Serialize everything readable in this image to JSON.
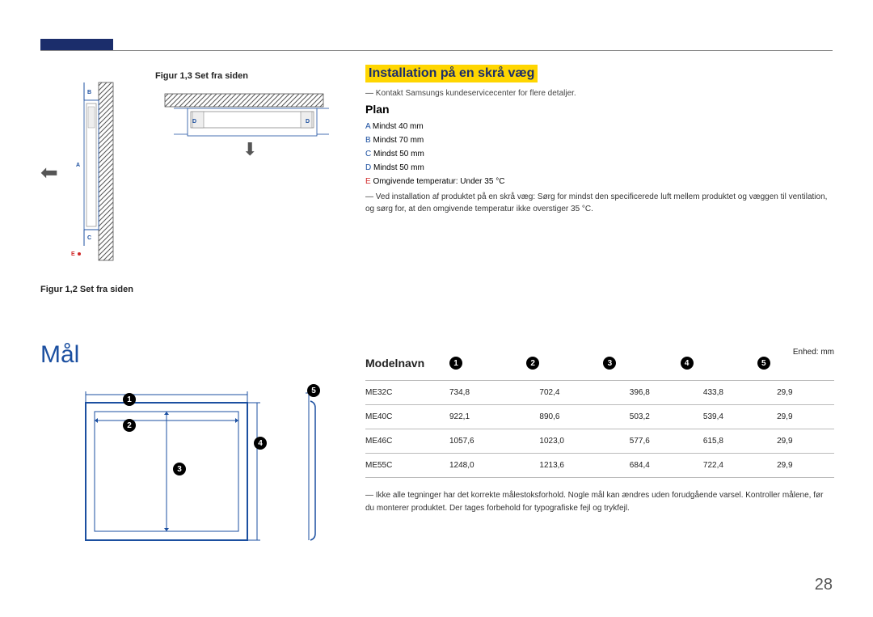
{
  "page_number": "28",
  "figures": {
    "fig13_caption": "Figur 1,3 Set fra siden",
    "fig12_caption": "Figur 1,2 Set fra siden",
    "label_A": "A",
    "label_B": "B",
    "label_C": "C",
    "label_D": "D",
    "label_E": "E"
  },
  "install": {
    "title": "Installation på en skrå væg",
    "contact": "Kontakt Samsungs kundeservicecenter for flere detaljer.",
    "plan_heading": "Plan",
    "specs": {
      "A": "Mindst 40 mm",
      "B": "Mindst 70 mm",
      "C": "Mindst 50 mm",
      "D": "Mindst 50 mm",
      "E": "Omgivende temperatur: Under 35 °C"
    },
    "note": "Ved installation af produktet på en skrå væg: Sørg for mindst den specificerede luft mellem produktet og væggen til ventilation, og sørg for, at den omgivende temperatur ikke overstiger 35 °C."
  },
  "maal": {
    "title": "Mål",
    "unit": "Enhed: mm",
    "model_header": "Modelnavn",
    "badges": [
      "1",
      "2",
      "3",
      "4",
      "5"
    ]
  },
  "chart_data": {
    "type": "table",
    "title": "Mål",
    "columns": [
      "Modelnavn",
      "1",
      "2",
      "3",
      "4",
      "5"
    ],
    "rows": [
      {
        "model": "ME32C",
        "c1": "734,8",
        "c2": "702,4",
        "c3": "396,8",
        "c4": "433,8",
        "c5": "29,9"
      },
      {
        "model": "ME40C",
        "c1": "922,1",
        "c2": "890,6",
        "c3": "503,2",
        "c4": "539,4",
        "c5": "29,9"
      },
      {
        "model": "ME46C",
        "c1": "1057,6",
        "c2": "1023,0",
        "c3": "577,6",
        "c4": "615,8",
        "c5": "29,9"
      },
      {
        "model": "ME55C",
        "c1": "1248,0",
        "c2": "1213,6",
        "c3": "684,4",
        "c4": "722,4",
        "c5": "29,9"
      }
    ],
    "footnote": "Ikke alle tegninger har det korrekte målestoksforhold. Nogle mål kan ændres uden forudgående varsel. Kontroller målene, før du monterer produktet. Der tages forbehold for typografiske fejl og trykfejl."
  }
}
